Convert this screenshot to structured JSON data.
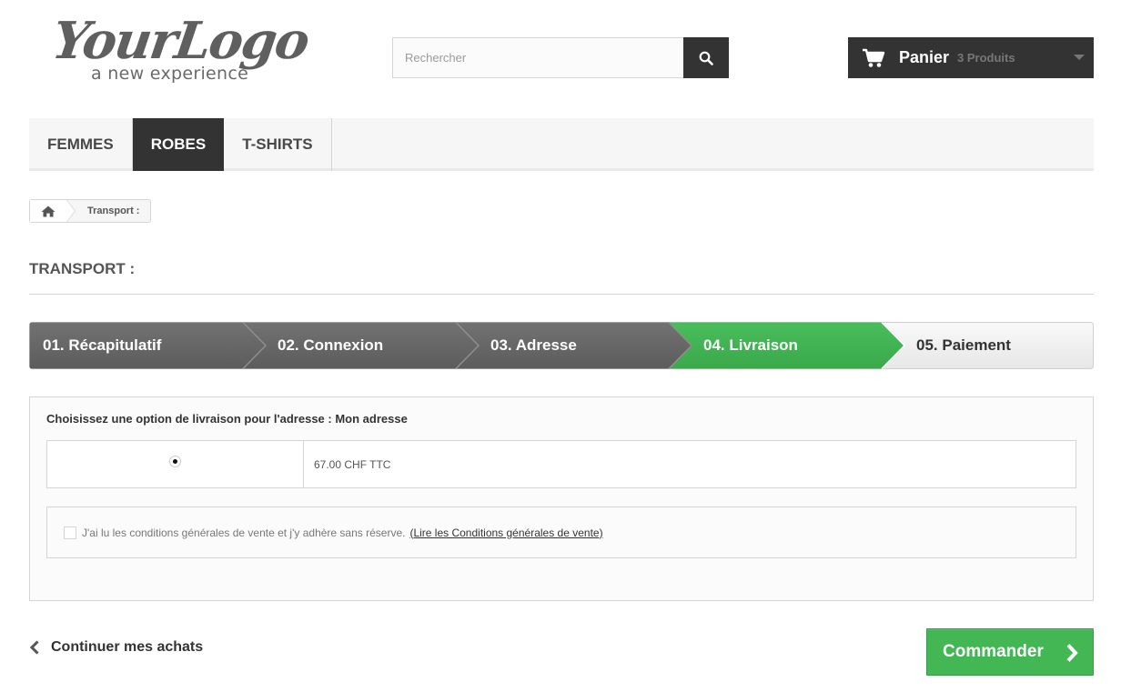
{
  "logo": {
    "main": "YourLogo",
    "sub": "a new experience"
  },
  "search": {
    "placeholder": "Rechercher",
    "value": ""
  },
  "cart": {
    "label": "Panier",
    "count": "3 Produits"
  },
  "nav": {
    "items": [
      "FEMMES",
      "ROBES",
      "T-SHIRTS"
    ],
    "active_index": 1
  },
  "breadcrumb": {
    "current": "Transport :"
  },
  "page": {
    "title": "TRANSPORT :"
  },
  "steps": {
    "items": [
      "01. Récapitulatif",
      "02. Connexion",
      "03. Adresse",
      "04. Livraison",
      "05. Paiement"
    ],
    "active_index": 3
  },
  "delivery": {
    "heading": "Choisissez une option de livraison pour l'adresse : Mon adresse",
    "price": "67.00 CHF TTC",
    "selected": true,
    "terms_text": "J'ai lu les conditions générales de vente et j'y adhère sans réserve.",
    "terms_link": "(Lire les Conditions générales de vente)",
    "terms_checked": false
  },
  "footer": {
    "continue_label": "Continuer mes achats",
    "order_label": "Commander"
  },
  "colors": {
    "dark": "#333333",
    "green": "#43b754",
    "step_inactive": "#666666",
    "step_last": "#f0f0f0"
  }
}
